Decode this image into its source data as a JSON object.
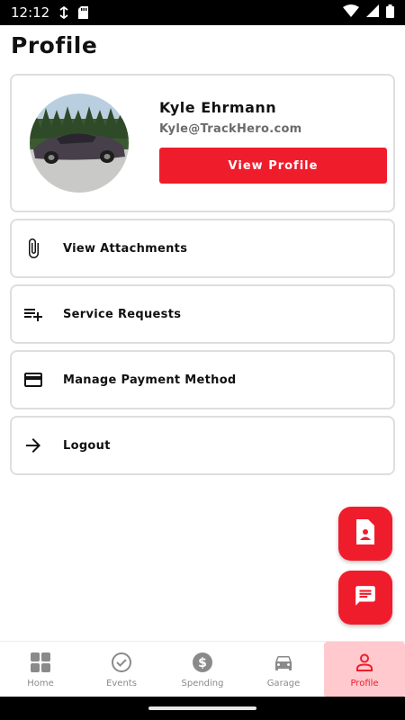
{
  "status_bar": {
    "time": "12:12"
  },
  "page": {
    "title": "Profile"
  },
  "profile": {
    "name": "Kyle Ehrmann",
    "email": "Kyle@TrackHero.com",
    "view_profile_label": "View Profile"
  },
  "menu": [
    {
      "label": "View Attachments",
      "icon": "paperclip-icon"
    },
    {
      "label": "Service Requests",
      "icon": "playlist-add-icon"
    },
    {
      "label": "Manage Payment Method",
      "icon": "credit-card-icon"
    },
    {
      "label": "Logout",
      "icon": "arrow-right-icon"
    }
  ],
  "fabs": [
    {
      "icon": "contact-document-icon"
    },
    {
      "icon": "chat-icon"
    }
  ],
  "bottom_nav": [
    {
      "label": "Home",
      "icon": "grid-icon"
    },
    {
      "label": "Events",
      "icon": "check-circle-icon"
    },
    {
      "label": "Spending",
      "icon": "dollar-circle-icon"
    },
    {
      "label": "Garage",
      "icon": "car-icon"
    },
    {
      "label": "Profile",
      "icon": "person-icon",
      "active": true
    }
  ],
  "colors": {
    "accent": "#ef1d2c",
    "active_tab_bg": "#ffc9cd",
    "inactive": "#8a8a8a"
  }
}
